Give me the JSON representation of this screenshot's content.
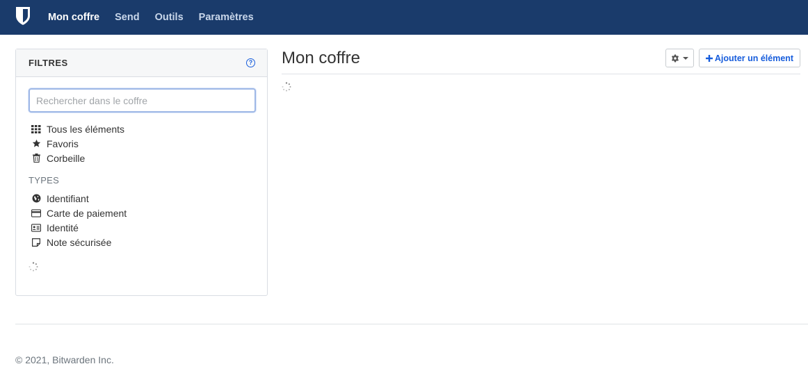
{
  "nav": {
    "links": [
      "Mon coffre",
      "Send",
      "Outils",
      "Paramètres"
    ]
  },
  "filters": {
    "title": "FILTRES",
    "search_placeholder": "Rechercher dans le coffre",
    "items": [
      "Tous les éléments",
      "Favoris",
      "Corbeille"
    ],
    "types_heading": "TYPES",
    "types": [
      "Identifiant",
      "Carte de paiement",
      "Identité",
      "Note sécurisée"
    ]
  },
  "main": {
    "title": "Mon coffre",
    "add_button": "Ajouter un élément"
  },
  "footer": {
    "copyright": "© 2021, Bitwarden Inc."
  },
  "colors": {
    "navbar": "#1a3b6b",
    "accent": "#175ddc"
  }
}
